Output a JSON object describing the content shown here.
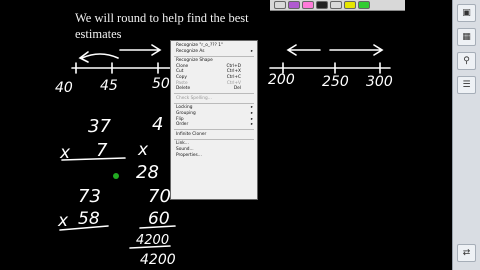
{
  "board": {
    "heading_line1": "We will round to help find the best",
    "heading_line2": "estimates"
  },
  "toolbar": {
    "pen_colors": [
      "#d9d9d9",
      "#b05ad0",
      "#ff7ad9",
      "#222222",
      "#d9d9d9",
      "#e6e600",
      "#33cc33"
    ]
  },
  "ink": {
    "color": "#ffffff",
    "accent_color": "#22aa22",
    "numberline_left": [
      "40",
      "45",
      "50"
    ],
    "numberline_right": [
      "200",
      "250",
      "300"
    ],
    "problem1": {
      "top": "37",
      "times": "x",
      "bottom": "7"
    },
    "problem2": {
      "top": "4",
      "times": "x",
      "bottom": "28"
    },
    "problem3": {
      "top": "73",
      "times": "x",
      "bottom": "58"
    },
    "problem4": {
      "top": "70",
      "bottom": "60",
      "work1": "4200",
      "work2": "4200"
    }
  },
  "context_menu": {
    "items": [
      {
        "label": "Recognize \"r_o_??? 1\"",
        "shortcut": "",
        "arrow": false,
        "disabled": false
      },
      {
        "label": "Recognize As",
        "shortcut": "",
        "arrow": true,
        "disabled": false
      },
      {
        "sep": true
      },
      {
        "label": "Recognize Shape",
        "shortcut": "",
        "arrow": false,
        "disabled": false
      },
      {
        "label": "Clone",
        "shortcut": "Ctrl+D",
        "arrow": false,
        "disabled": false
      },
      {
        "label": "Cut",
        "shortcut": "Ctrl+X",
        "arrow": false,
        "disabled": false
      },
      {
        "label": "Copy",
        "shortcut": "Ctrl+C",
        "arrow": false,
        "disabled": false
      },
      {
        "label": "Paste",
        "shortcut": "Ctrl+V",
        "arrow": false,
        "disabled": true
      },
      {
        "label": "Delete",
        "shortcut": "Del",
        "arrow": false,
        "disabled": false
      },
      {
        "sep": true
      },
      {
        "label": "Check Spelling...",
        "shortcut": "",
        "arrow": false,
        "disabled": true
      },
      {
        "sep": true
      },
      {
        "label": "Locking",
        "shortcut": "",
        "arrow": true,
        "disabled": false
      },
      {
        "label": "Grouping",
        "shortcut": "",
        "arrow": true,
        "disabled": false
      },
      {
        "label": "Flip",
        "shortcut": "",
        "arrow": true,
        "disabled": false
      },
      {
        "label": "Order",
        "shortcut": "",
        "arrow": true,
        "disabled": false
      },
      {
        "sep": true
      },
      {
        "label": "Infinite Cloner",
        "shortcut": "",
        "arrow": false,
        "disabled": false
      },
      {
        "sep": true
      },
      {
        "label": "Link...",
        "shortcut": "",
        "arrow": false,
        "disabled": false
      },
      {
        "label": "Sound...",
        "shortcut": "",
        "arrow": false,
        "disabled": false
      },
      {
        "label": "Properties...",
        "shortcut": "",
        "arrow": false,
        "disabled": false
      }
    ]
  },
  "sidebar": {
    "buttons": [
      {
        "icon": "page-sorter-icon",
        "glyph": "▣"
      },
      {
        "icon": "gallery-icon",
        "glyph": "▦"
      },
      {
        "icon": "attachments-icon",
        "glyph": "⚲"
      },
      {
        "icon": "properties-icon",
        "glyph": "☰"
      },
      {
        "icon": "arrow-icon",
        "glyph": "⇄"
      }
    ]
  }
}
